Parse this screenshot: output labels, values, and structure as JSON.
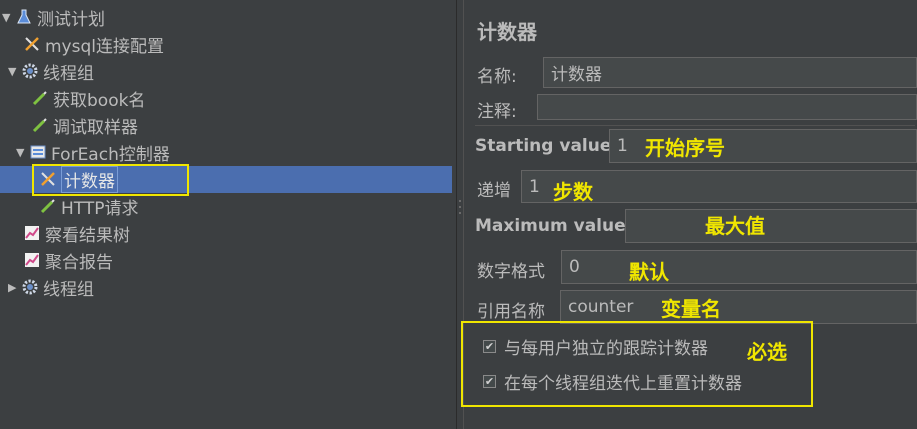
{
  "tree": {
    "items": [
      {
        "label": "测试计划",
        "icon": "flask-icon"
      },
      {
        "label": "mysql连接配置",
        "icon": "wrench-icon"
      },
      {
        "label": "线程组",
        "icon": "gear-icon"
      },
      {
        "label": "获取book名",
        "icon": "pipette-icon"
      },
      {
        "label": "调试取样器",
        "icon": "pipette-icon"
      },
      {
        "label": "ForEach控制器",
        "icon": "controller-icon"
      },
      {
        "label": "计数器",
        "icon": "wrench-icon"
      },
      {
        "label": "HTTP请求",
        "icon": "pipette-icon"
      },
      {
        "label": "察看结果树",
        "icon": "chart-icon"
      },
      {
        "label": "聚合报告",
        "icon": "chart-icon"
      },
      {
        "label": "线程组",
        "icon": "gear-icon"
      }
    ]
  },
  "panel": {
    "title": "计数器",
    "name_label": "名称:",
    "name_value": "计数器",
    "comment_label": "注释:",
    "comment_value": "",
    "start_label": "Starting value",
    "start_value": "1",
    "increment_label": "递增",
    "increment_value": "1",
    "max_label": "Maximum value",
    "max_value": "",
    "format_label": "数字格式",
    "format_value": "0",
    "refname_label": "引用名称",
    "refname_value": "counter",
    "check_per_user": "与每用户独立的跟踪计数器",
    "check_reset": "在每个线程组迭代上重置计数器"
  },
  "annotations": {
    "start": "开始序号",
    "increment": "步数",
    "max": "最大值",
    "format": "默认",
    "refname": "变量名",
    "required": "必选"
  },
  "colors": {
    "background": "#3c3f41",
    "selection": "#4b6eaf",
    "highlight": "#f0e600",
    "text": "#bbbbbb"
  }
}
